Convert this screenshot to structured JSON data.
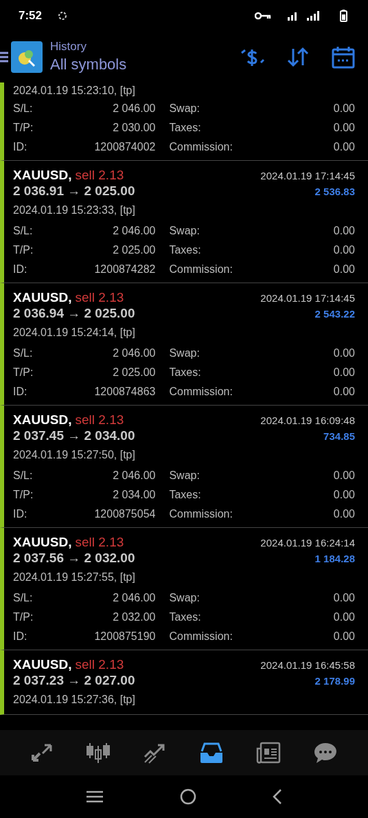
{
  "status_bar": {
    "time": "7:52"
  },
  "header": {
    "subtitle": "History",
    "title": "All symbols"
  },
  "deals": [
    {
      "open_time": "2024.01.19 15:23:10, [tp]",
      "fields": [
        {
          "label": "S/L:",
          "value": "2 046.00"
        },
        {
          "label": "Swap:",
          "value": "0.00"
        },
        {
          "label": "T/P:",
          "value": "2 030.00"
        },
        {
          "label": "Taxes:",
          "value": "0.00"
        },
        {
          "label": "ID:",
          "value": "1200874002"
        },
        {
          "label": "Commission:",
          "value": "0.00"
        }
      ]
    },
    {
      "symbol": "XAUUSD,",
      "side": "sell 2.13",
      "prices": "2 036.91 → 2 025.00",
      "close_time": "2024.01.19 17:14:45",
      "profit": "2 536.83",
      "open_time": "2024.01.19 15:23:33, [tp]",
      "fields": [
        {
          "label": "S/L:",
          "value": "2 046.00"
        },
        {
          "label": "Swap:",
          "value": "0.00"
        },
        {
          "label": "T/P:",
          "value": "2 025.00"
        },
        {
          "label": "Taxes:",
          "value": "0.00"
        },
        {
          "label": "ID:",
          "value": "1200874282"
        },
        {
          "label": "Commission:",
          "value": "0.00"
        }
      ]
    },
    {
      "symbol": "XAUUSD,",
      "side": "sell 2.13",
      "prices": "2 036.94 → 2 025.00",
      "close_time": "2024.01.19 17:14:45",
      "profit": "2 543.22",
      "open_time": "2024.01.19 15:24:14, [tp]",
      "fields": [
        {
          "label": "S/L:",
          "value": "2 046.00"
        },
        {
          "label": "Swap:",
          "value": "0.00"
        },
        {
          "label": "T/P:",
          "value": "2 025.00"
        },
        {
          "label": "Taxes:",
          "value": "0.00"
        },
        {
          "label": "ID:",
          "value": "1200874863"
        },
        {
          "label": "Commission:",
          "value": "0.00"
        }
      ]
    },
    {
      "symbol": "XAUUSD,",
      "side": "sell 2.13",
      "prices": "2 037.45 → 2 034.00",
      "close_time": "2024.01.19 16:09:48",
      "profit": "734.85",
      "open_time": "2024.01.19 15:27:50, [tp]",
      "fields": [
        {
          "label": "S/L:",
          "value": "2 046.00"
        },
        {
          "label": "Swap:",
          "value": "0.00"
        },
        {
          "label": "T/P:",
          "value": "2 034.00"
        },
        {
          "label": "Taxes:",
          "value": "0.00"
        },
        {
          "label": "ID:",
          "value": "1200875054"
        },
        {
          "label": "Commission:",
          "value": "0.00"
        }
      ]
    },
    {
      "symbol": "XAUUSD,",
      "side": "sell 2.13",
      "prices": "2 037.56 → 2 032.00",
      "close_time": "2024.01.19 16:24:14",
      "profit": "1 184.28",
      "open_time": "2024.01.19 15:27:55, [tp]",
      "fields": [
        {
          "label": "S/L:",
          "value": "2 046.00"
        },
        {
          "label": "Swap:",
          "value": "0.00"
        },
        {
          "label": "T/P:",
          "value": "2 032.00"
        },
        {
          "label": "Taxes:",
          "value": "0.00"
        },
        {
          "label": "ID:",
          "value": "1200875190"
        },
        {
          "label": "Commission:",
          "value": "0.00"
        }
      ]
    },
    {
      "symbol": "XAUUSD,",
      "side": "sell 2.13",
      "prices": "2 037.23 → 2 027.00",
      "close_time": "2024.01.19 16:45:58",
      "profit": "2 178.99",
      "open_time": "2024.01.19 15:27:36, [tp]"
    }
  ],
  "bottom_nav": [
    {
      "kind": "trade",
      "selected": false
    },
    {
      "kind": "quotes",
      "selected": false
    },
    {
      "kind": "chart",
      "selected": false
    },
    {
      "kind": "history",
      "selected": true
    },
    {
      "kind": "news",
      "selected": false
    },
    {
      "kind": "chat",
      "selected": false
    }
  ]
}
